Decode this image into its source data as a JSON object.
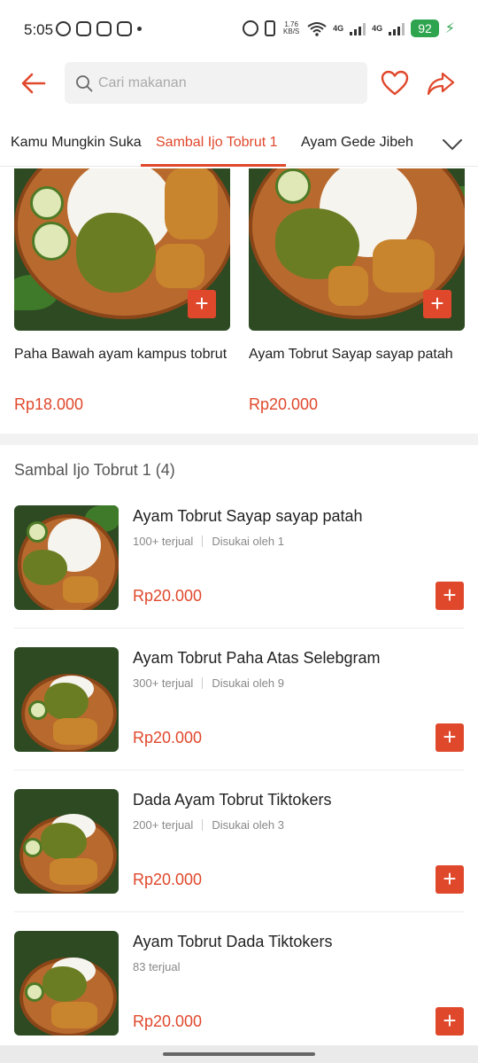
{
  "status_bar": {
    "time": "5:05",
    "net_speed": "1.76\nKB/S",
    "network_1": "4G",
    "network_2": "4G",
    "battery": "92"
  },
  "header": {
    "search_placeholder": "Cari makanan"
  },
  "tabs": [
    {
      "label": "Kamu Mungkin Suka",
      "active": false
    },
    {
      "label": "Sambal Ijo Tobrut 1",
      "active": true
    },
    {
      "label": "Ayam Gede Jibeh",
      "active": false
    }
  ],
  "top_cards": [
    {
      "name": "Paha Bawah ayam kampus tobrut",
      "price": "Rp18.000"
    },
    {
      "name": "Ayam Tobrut Sayap sayap patah",
      "price": "Rp20.000"
    }
  ],
  "section": {
    "title": "Sambal Ijo Tobrut 1 (4)"
  },
  "items": [
    {
      "name": "Ayam Tobrut Sayap sayap patah",
      "sold": "100+ terjual",
      "likes": "Disukai oleh 1",
      "price": "Rp20.000"
    },
    {
      "name": "Ayam Tobrut Paha Atas Selebgram",
      "sold": "300+ terjual",
      "likes": "Disukai oleh 9",
      "price": "Rp20.000"
    },
    {
      "name": "Dada Ayam Tobrut Tiktokers",
      "sold": "200+ terjual",
      "likes": "Disukai oleh 3",
      "price": "Rp20.000"
    },
    {
      "name": "Ayam Tobrut Dada Tiktokers",
      "sold": "83 terjual",
      "likes": "",
      "price": "Rp20.000"
    }
  ],
  "colors": {
    "accent": "#e0482c",
    "battery": "#2ea44f"
  }
}
